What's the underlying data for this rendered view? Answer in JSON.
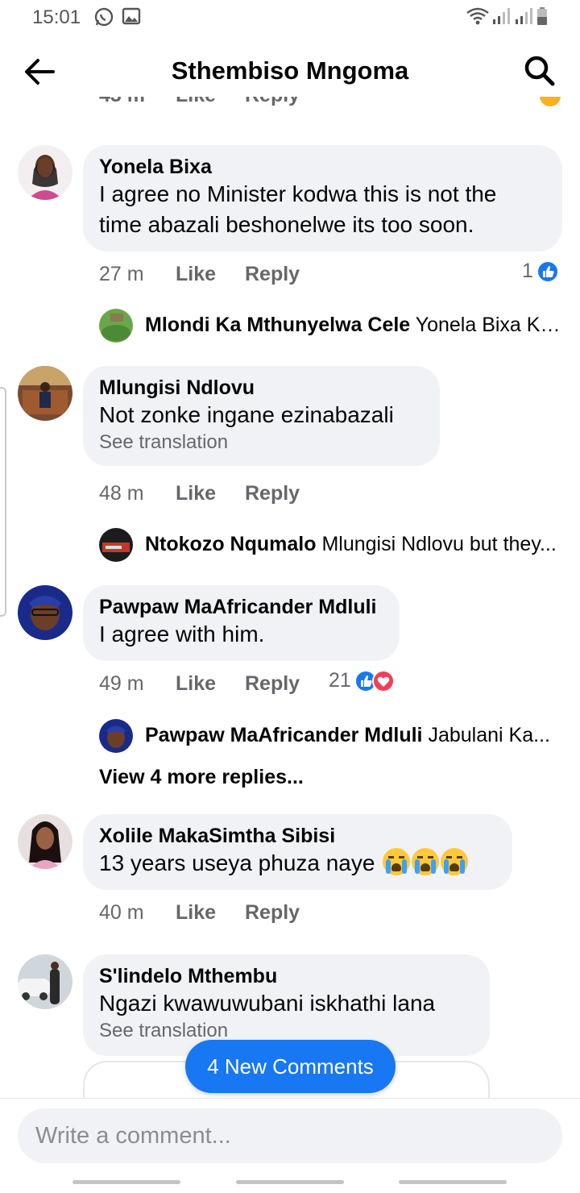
{
  "status_bar": {
    "time": "15:01"
  },
  "header": {
    "title": "Sthembiso Mngoma"
  },
  "cut_row": {
    "time": "43 m",
    "like": "Like",
    "reply": "Reply"
  },
  "comments": [
    {
      "author": "Yonela Bixa",
      "text_lines": [
        "I agree no Minister kodwa this is not the",
        "time abazali beshonelwe its too soon."
      ],
      "time": "27 m",
      "like": "Like",
      "reply": "Reply",
      "reactions": {
        "count": "1"
      },
      "reply_preview": {
        "name": "Mlondi Ka Mthunyelwa Cele",
        "snippet": "Yonela Bixa  Ku..."
      }
    },
    {
      "author": "Mlungisi Ndlovu",
      "text": "Not zonke ingane ezinabazali",
      "see_translation": "See translation",
      "time": "48 m",
      "like": "Like",
      "reply": "Reply",
      "reply_preview": {
        "name": "Ntokozo Nqumalo",
        "snippet": "Mlungisi Ndlovu but they..."
      }
    },
    {
      "author": "Pawpaw MaAfricander Mdluli",
      "text": "I agree with him.",
      "time": "49 m",
      "like": "Like",
      "reply": "Reply",
      "reactions": {
        "count": "21"
      },
      "reply_preview": {
        "name": "Pawpaw MaAfricander Mdluli",
        "snippet": "Jabulani Ka..."
      },
      "more_replies": "View 4 more replies..."
    },
    {
      "author": "Xolile MakaSimtha Sibisi",
      "text": "13 years useya phuza naye",
      "emoji": "loudly-crying-face",
      "time": "40 m",
      "like": "Like",
      "reply": "Reply"
    },
    {
      "author": "S'lindelo Mthembu",
      "text": "Ngazi kwawuwubani iskhathi lana",
      "see_translation": "See translation"
    }
  ],
  "new_comments_pill": "4 New Comments",
  "composer": {
    "placeholder": "Write a comment..."
  },
  "colors": {
    "accent": "#1877f2",
    "love": "#f33e58",
    "bubble": "#f0f2f5",
    "muted": "#65676b"
  }
}
